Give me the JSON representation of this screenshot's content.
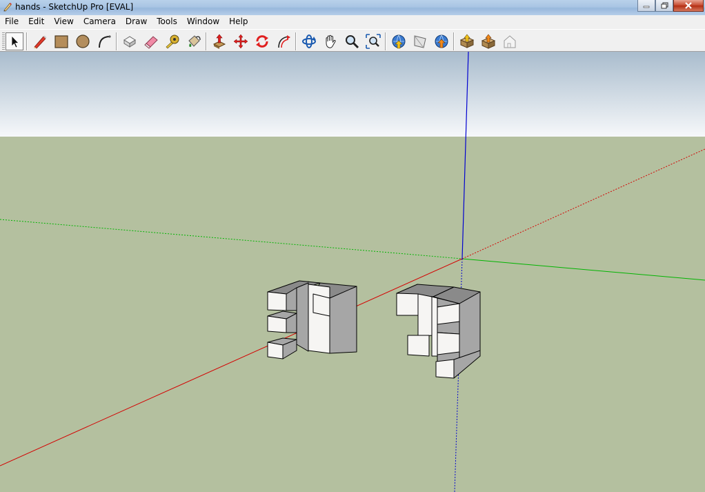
{
  "window": {
    "title": "hands - SketchUp Pro [EVAL]"
  },
  "menu": {
    "items": [
      "File",
      "Edit",
      "View",
      "Camera",
      "Draw",
      "Tools",
      "Window",
      "Help"
    ]
  },
  "toolbar": {
    "buttons": [
      {
        "name": "select-tool",
        "icon": "arrow-cursor-icon"
      },
      {
        "name": "line-tool",
        "icon": "pencil-icon"
      },
      {
        "name": "rectangle-tool",
        "icon": "rectangle-icon"
      },
      {
        "name": "circle-tool",
        "icon": "circle-icon"
      },
      {
        "name": "arc-tool",
        "icon": "arc-icon"
      },
      {
        "name": "make-component-tool",
        "icon": "component-icon"
      },
      {
        "name": "eraser-tool",
        "icon": "eraser-icon"
      },
      {
        "name": "tape-measure-tool",
        "icon": "tape-measure-icon"
      },
      {
        "name": "paint-bucket-tool",
        "icon": "paint-bucket-icon"
      },
      {
        "name": "push-pull-tool",
        "icon": "push-pull-icon"
      },
      {
        "name": "move-tool",
        "icon": "move-icon"
      },
      {
        "name": "rotate-tool",
        "icon": "rotate-icon"
      },
      {
        "name": "offset-tool",
        "icon": "offset-icon"
      },
      {
        "name": "orbit-tool",
        "icon": "orbit-icon"
      },
      {
        "name": "pan-tool",
        "icon": "hand-icon"
      },
      {
        "name": "zoom-tool",
        "icon": "magnifier-icon"
      },
      {
        "name": "zoom-extents-tool",
        "icon": "zoom-extents-icon"
      },
      {
        "name": "get-models-tool",
        "icon": "globe-download-icon"
      },
      {
        "name": "share-model-tool",
        "icon": "share-model-icon"
      },
      {
        "name": "share-component-tool",
        "icon": "globe-upload-icon"
      },
      {
        "name": "get-photo-textures-tool",
        "icon": "box-download-icon"
      },
      {
        "name": "extension-warehouse-tool",
        "icon": "box-upload-icon"
      },
      {
        "name": "preview-in-earth-tool",
        "icon": "house-icon"
      }
    ]
  },
  "colors": {
    "sky_top": "#a9bccd",
    "sky_bottom": "#f6f8fa",
    "ground": "#b4c09f",
    "axis_red": "#d40000",
    "axis_green": "#00b400",
    "axis_blue": "#0000d0",
    "face_light": "#f6f5f3",
    "face_dark": "#a6a6a6",
    "face_top": "#8a8a8a"
  }
}
